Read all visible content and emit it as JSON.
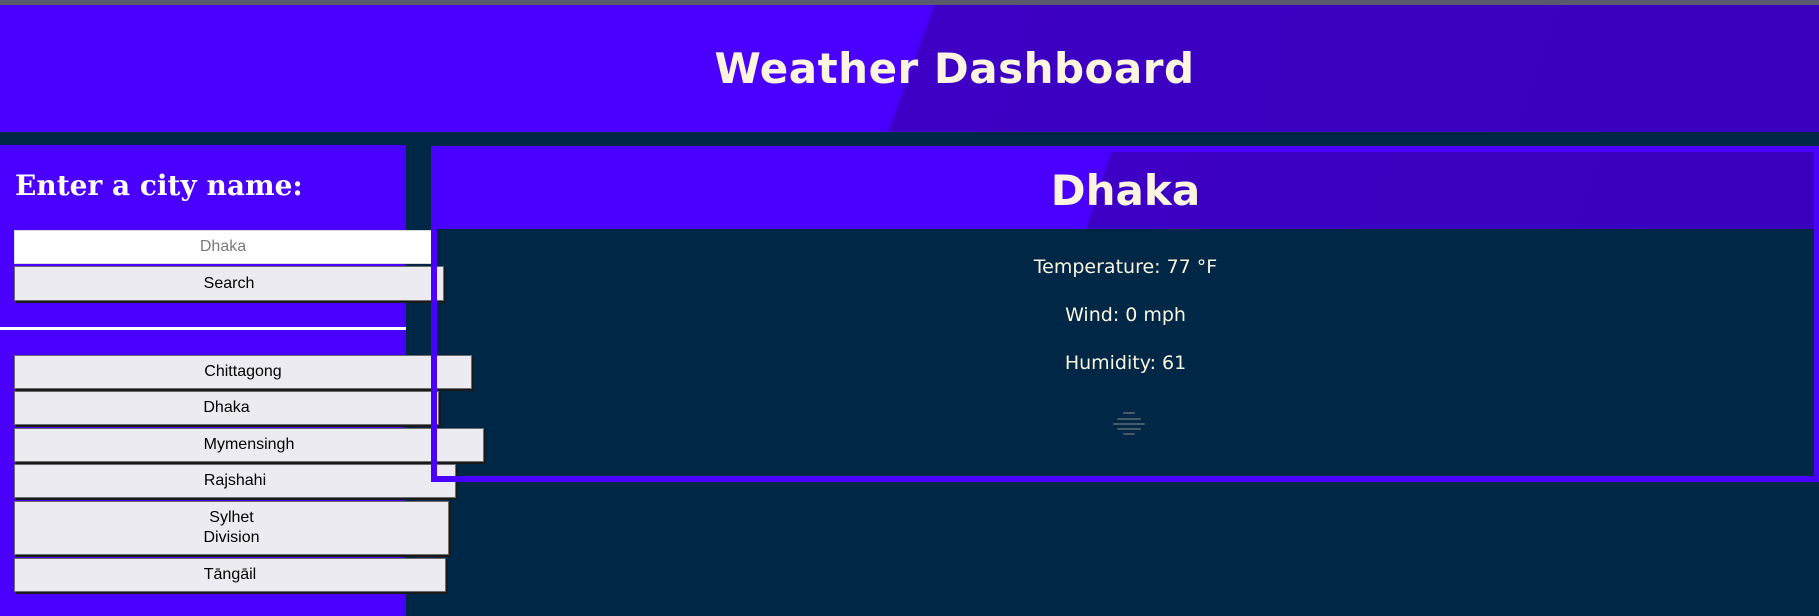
{
  "header": {
    "title": "Weather Dashboard"
  },
  "sidebar": {
    "heading": "Enter a city name:",
    "search": {
      "value": "",
      "placeholder": "Dhaka",
      "button_label": "Search"
    },
    "history": [
      {
        "label": "Chittagong"
      },
      {
        "label": "Dhaka"
      },
      {
        "label": "Mymensingh"
      },
      {
        "label": "Rajshahi"
      },
      {
        "label": "Sylhet Division"
      },
      {
        "label": "Tāngāil"
      }
    ]
  },
  "current": {
    "city": "Dhaka",
    "temperature_label": "Temperature:",
    "temperature_value": "77",
    "temperature_unit": "°F",
    "wind_label": "Wind:",
    "wind_value": "0",
    "wind_unit": "mph",
    "humidity_label": "Humidity:",
    "humidity_value": "61",
    "icon": "haze-icon"
  },
  "colors": {
    "page_bg": "#012747",
    "accent_purple": "#4a00ff",
    "accent_purple_dark": "#3a00bd",
    "title_text": "#fbf5e0",
    "button_bg": "#ecebf2"
  }
}
